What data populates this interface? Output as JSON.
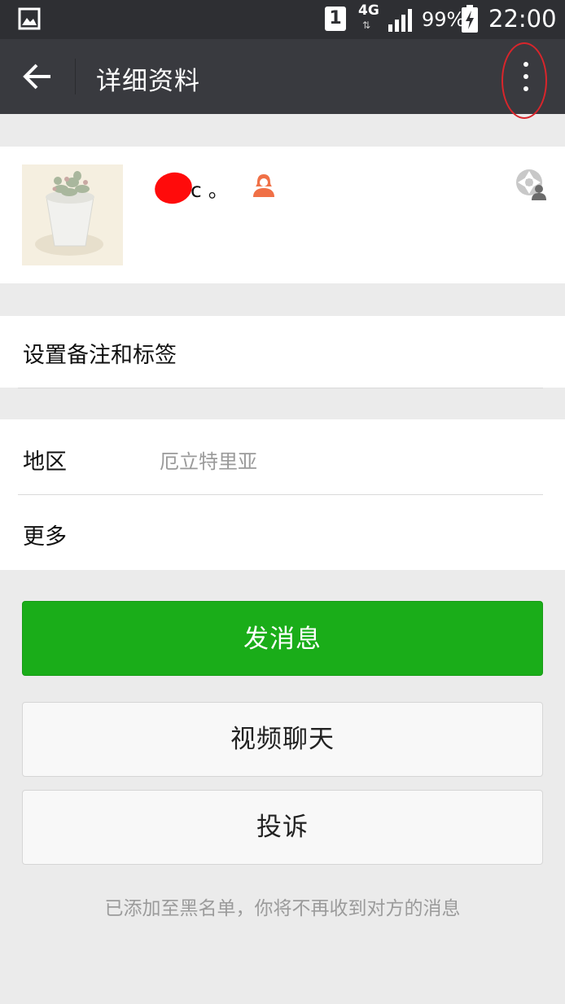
{
  "status_bar": {
    "sim_slot": "1",
    "network": "4G",
    "battery_percent": "99%",
    "time": "22:00"
  },
  "header": {
    "title": "详细资料",
    "back_icon": "arrow-left-icon",
    "more_icon": "more-vertical-icon"
  },
  "profile": {
    "name": "c 。",
    "gender_icon": "female-user-icon",
    "moments_icon": "moments-camera-icon"
  },
  "cells": {
    "remark": {
      "label": "设置备注和标签"
    },
    "region": {
      "label": "地区",
      "value": "厄立特里亚"
    },
    "more": {
      "label": "更多"
    }
  },
  "actions": {
    "send_message": "发消息",
    "video_chat": "视频聊天",
    "report": "投诉"
  },
  "footer": {
    "tip": "已添加至黑名单，你将不再收到对方的消息"
  },
  "colors": {
    "status_bar": "#2e2f33",
    "title_bar": "#393a3f",
    "primary_green": "#1aad19",
    "highlight_red": "#d9252b",
    "page_bg": "#ebebeb"
  }
}
